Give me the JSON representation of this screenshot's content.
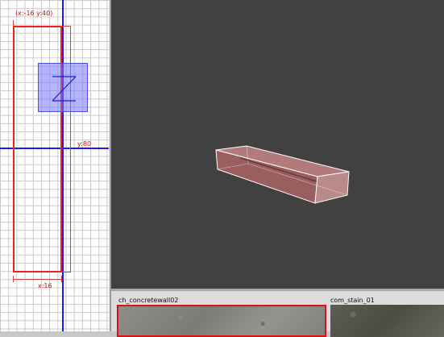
{
  "grid_view": {
    "label_top": "(x:-16  y:40)",
    "label_right": "y:80",
    "label_bottom": "x:16"
  },
  "textures": [
    {
      "name": "ch_concretewall02",
      "selected": true
    },
    {
      "name": "com_stain_01",
      "selected": false
    }
  ],
  "colors": {
    "grid_background": "#ffffff",
    "axis": "#1a1aff",
    "selection": "#e22",
    "entity": "#7878ff",
    "viewport_3d_background": "#414141",
    "brush_fill": "#a86060"
  }
}
